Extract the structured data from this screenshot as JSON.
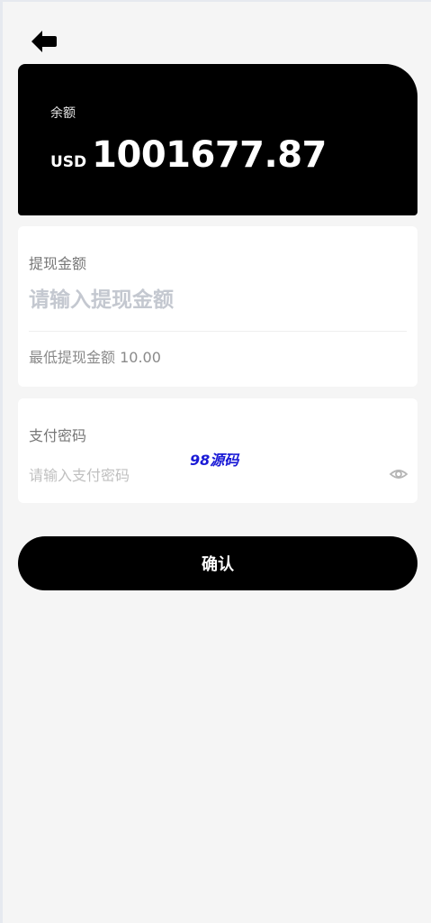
{
  "balance": {
    "label": "余额",
    "currency": "USD",
    "amount": "1001677.87"
  },
  "withdraw": {
    "label": "提现金额",
    "placeholder": "请输入提现金额",
    "min_text": "最低提现金额 10.00"
  },
  "password": {
    "label": "支付密码",
    "placeholder": "请输入支付密码"
  },
  "watermark": "98源码",
  "confirm_label": "确认",
  "icons": {
    "back": "arrow-left-icon",
    "eye": "eye-icon"
  },
  "colors": {
    "card": "#000000",
    "page_bg": "#f5f5f5",
    "watermark": "#1a1ad6"
  }
}
